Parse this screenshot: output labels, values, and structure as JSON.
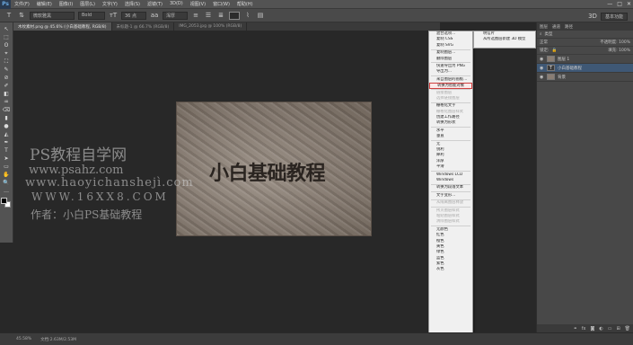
{
  "app": {
    "logo": "Ps"
  },
  "menubar": {
    "items": [
      "文件(F)",
      "编辑(E)",
      "图像(I)",
      "图层(L)",
      "文字(Y)",
      "选择(S)",
      "滤镜(T)",
      "3D(D)",
      "视图(V)",
      "窗口(W)",
      "帮助(H)"
    ],
    "window_controls": [
      "—",
      "□",
      "✕"
    ]
  },
  "options": {
    "font_family": "微软雅黑",
    "font_style": "Bold",
    "font_size": "36 点",
    "antialias": "浑厚",
    "workspace": "基本功能"
  },
  "tabs": [
    {
      "label": "木纹素材.png @ 45.6% (小白基础教程, RGB/8)",
      "active": true
    },
    {
      "label": "未标题-1 @ 66.7% (RGB/8)",
      "active": false
    },
    {
      "label": "IMG_2053.jpg @ 100% (RGB/8)",
      "active": false
    }
  ],
  "tools": [
    "↖",
    "⬚",
    "ʘ",
    "⌖",
    "⛶",
    "✎",
    "⊘",
    "✐",
    "◧",
    "♒",
    "⌫",
    "▮",
    "●",
    "◭",
    "✒",
    "T",
    "➤",
    "▭",
    "✋",
    "🔍",
    "…"
  ],
  "canvas": {
    "text": "小白基础教程"
  },
  "watermark": {
    "line1": "PS教程自学网",
    "line2": "www.psahz.com",
    "line3": "www.haoyichanshejì.com",
    "line4": "WWW.16XX8.COM",
    "line5": "作者：小白PS基础教程"
  },
  "context_menu": {
    "items": [
      {
        "label": "混合选项...",
        "disabled": false
      },
      {
        "label": "复制 CSS",
        "disabled": false
      },
      {
        "label": "复制 SVG",
        "disabled": false
      },
      {
        "sep": true
      },
      {
        "label": "复制图层...",
        "disabled": false
      },
      {
        "label": "删除图层",
        "disabled": false
      },
      {
        "sep": true
      },
      {
        "label": "快速导出为 PNG",
        "disabled": false
      },
      {
        "label": "导出为...",
        "disabled": false
      },
      {
        "sep": true
      },
      {
        "label": "来自图层的画板...",
        "disabled": false
      },
      {
        "label": "转换为智能对象",
        "disabled": false,
        "highlight": true
      },
      {
        "sep": true
      },
      {
        "label": "链接图层",
        "disabled": true
      },
      {
        "label": "选择链接图层",
        "disabled": true
      },
      {
        "sep": true
      },
      {
        "label": "栅格化文字",
        "disabled": false
      },
      {
        "label": "栅格化图层样式",
        "disabled": true
      },
      {
        "label": "创建工作路径",
        "disabled": false
      },
      {
        "label": "转换为形状",
        "disabled": false
      },
      {
        "sep": true
      },
      {
        "label": "水平",
        "disabled": false
      },
      {
        "label": "垂直",
        "disabled": false
      },
      {
        "sep": true
      },
      {
        "label": "无",
        "disabled": false
      },
      {
        "label": "锐利",
        "disabled": false
      },
      {
        "label": "犀利",
        "disabled": false
      },
      {
        "label": "浑厚",
        "disabled": false
      },
      {
        "label": "平滑",
        "disabled": false
      },
      {
        "sep": true
      },
      {
        "label": "Windows LCD",
        "disabled": false
      },
      {
        "label": "Windows",
        "disabled": false
      },
      {
        "sep": true
      },
      {
        "label": "转换为段落文本",
        "disabled": false
      },
      {
        "sep": true
      },
      {
        "label": "文字变形...",
        "disabled": false
      },
      {
        "sep": true
      },
      {
        "label": "从隔离图层释放",
        "disabled": true
      },
      {
        "sep": true
      },
      {
        "label": "拷贝图层样式",
        "disabled": true
      },
      {
        "label": "粘贴图层样式",
        "disabled": true
      },
      {
        "label": "清除图层样式",
        "disabled": true
      },
      {
        "sep": true
      },
      {
        "label": "无颜色",
        "disabled": false
      },
      {
        "label": "红色",
        "disabled": false
      },
      {
        "label": "橙色",
        "disabled": false
      },
      {
        "label": "黄色",
        "disabled": false
      },
      {
        "label": "绿色",
        "disabled": false
      },
      {
        "label": "蓝色",
        "disabled": false
      },
      {
        "label": "紫色",
        "disabled": false
      },
      {
        "label": "灰色",
        "disabled": false
      }
    ],
    "submenu": [
      "明信片",
      "从所选图层新建 3D 模型"
    ]
  },
  "panels": {
    "tabs": [
      "图层",
      "通道",
      "路径"
    ],
    "filter_label": "类型",
    "mode": "正常",
    "opacity_label": "不透明度: 100%",
    "lock_label": "锁定:",
    "fill_label": "填充: 100%",
    "layers": [
      {
        "name": "图层 1",
        "thumb": "img",
        "selected": false
      },
      {
        "name": "小白基础教程",
        "thumb": "T",
        "selected": true
      },
      {
        "name": "背景",
        "thumb": "img",
        "selected": false
      }
    ]
  },
  "status": {
    "zoom": "45.58%",
    "doc": "文档:2.63M/2.53M"
  }
}
